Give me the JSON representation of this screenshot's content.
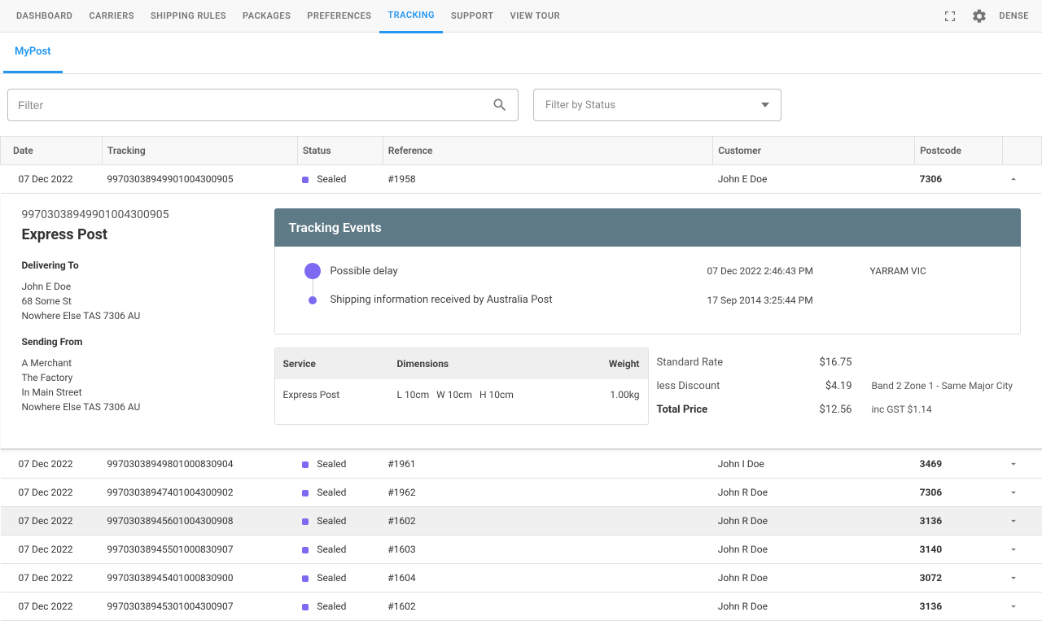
{
  "topnav": {
    "items": [
      "DASHBOARD",
      "CARRIERS",
      "SHIPPING RULES",
      "PACKAGES",
      "PREFERENCES",
      "TRACKING",
      "SUPPORT",
      "VIEW TOUR"
    ],
    "activeIndex": 5,
    "density": "DENSE"
  },
  "subnav": {
    "tab": "MyPost"
  },
  "filters": {
    "placeholder": "Filter",
    "statusPlaceholder": "Filter by Status"
  },
  "columns": [
    "Date",
    "Tracking",
    "Status",
    "Reference",
    "Customer",
    "Postcode",
    ""
  ],
  "rows": [
    {
      "date": "07 Dec 2022",
      "tracking": "99703038949901004300905",
      "status": "Sealed",
      "ref": "#1958",
      "customer": "John E Doe",
      "postcode": "7306",
      "expanded": true
    },
    {
      "date": "07 Dec 2022",
      "tracking": "99703038949801000830904",
      "status": "Sealed",
      "ref": "#1961",
      "customer": "John I Doe",
      "postcode": "3469"
    },
    {
      "date": "07 Dec 2022",
      "tracking": "99703038947401004300902",
      "status": "Sealed",
      "ref": "#1962",
      "customer": "John R Doe",
      "postcode": "7306"
    },
    {
      "date": "07 Dec 2022",
      "tracking": "99703038945601004300908",
      "status": "Sealed",
      "ref": "#1602",
      "customer": "John R Doe",
      "postcode": "3136",
      "hover": true
    },
    {
      "date": "07 Dec 2022",
      "tracking": "99703038945501000830907",
      "status": "Sealed",
      "ref": "#1603",
      "customer": "John R Doe",
      "postcode": "3140"
    },
    {
      "date": "07 Dec 2022",
      "tracking": "99703038945401000830900",
      "status": "Sealed",
      "ref": "#1604",
      "customer": "John R Doe",
      "postcode": "3072"
    },
    {
      "date": "07 Dec 2022",
      "tracking": "99703038945301004300907",
      "status": "Sealed",
      "ref": "#1602",
      "customer": "John R Doe",
      "postcode": "3136"
    }
  ],
  "detail": {
    "trackingNumber": "99703038949901004300905",
    "serviceName": "Express Post",
    "deliverHeader": "Delivering To",
    "deliverTo": [
      "John E Doe",
      "68 Some St",
      "Nowhere Else TAS 7306 AU"
    ],
    "sendHeader": "Sending From",
    "sendFrom": [
      "A Merchant",
      "The Factory",
      "In Main Street",
      "Nowhere Else TAS 7306 AU"
    ],
    "eventsTitle": "Tracking Events",
    "events": [
      {
        "desc": "Possible delay",
        "time": "07 Dec 2022 2:46:43 PM",
        "loc": "YARRAM VIC"
      },
      {
        "desc": "Shipping information received by Australia Post",
        "time": "17 Sep 2014 3:25:44 PM",
        "loc": ""
      }
    ],
    "dims": {
      "headers": {
        "service": "Service",
        "dims": "Dimensions",
        "weight": "Weight"
      },
      "service": "Express Post",
      "l": "L  10cm",
      "w": "W  10cm",
      "h": "H  10cm",
      "weight": "1.00kg"
    },
    "price": {
      "standard": {
        "label": "Standard Rate",
        "value": "$16.75"
      },
      "discount": {
        "label": "less Discount",
        "value": "$4.19",
        "note": "Band 2 Zone 1 - Same Major City"
      },
      "total": {
        "label": "Total Price",
        "value": "$12.56",
        "note": "inc GST $1.14"
      }
    }
  }
}
